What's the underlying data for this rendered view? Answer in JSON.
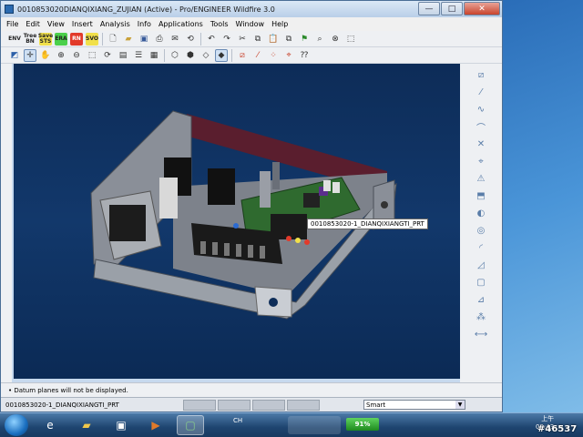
{
  "window": {
    "title": "0010853020DIANQIXIANG_ZUJIAN (Active) - Pro/ENGINEER Wildfire 3.0",
    "min_label": "—",
    "max_label": "□",
    "close_label": "✕"
  },
  "menu": [
    "File",
    "Edit",
    "View",
    "Insert",
    "Analysis",
    "Info",
    "Applications",
    "Tools",
    "Window",
    "Help"
  ],
  "toolbar1": {
    "buttons": [
      "ENV",
      "Tree BN",
      "Save STS",
      "ERA",
      "RN",
      "SVO"
    ]
  },
  "graphics": {
    "tooltip": "0010853020-1_DIANQIXIANGTI_PRT"
  },
  "message": "• Datum planes will not be displayed.",
  "status": {
    "selected": "0010853020-1_DIANQIXIANGTI_PRT",
    "filter": "Smart"
  },
  "taskbar": {
    "lang": "CH",
    "battery": "91%",
    "time": "09:43",
    "ampm": "上午",
    "watermark": "#46537"
  }
}
